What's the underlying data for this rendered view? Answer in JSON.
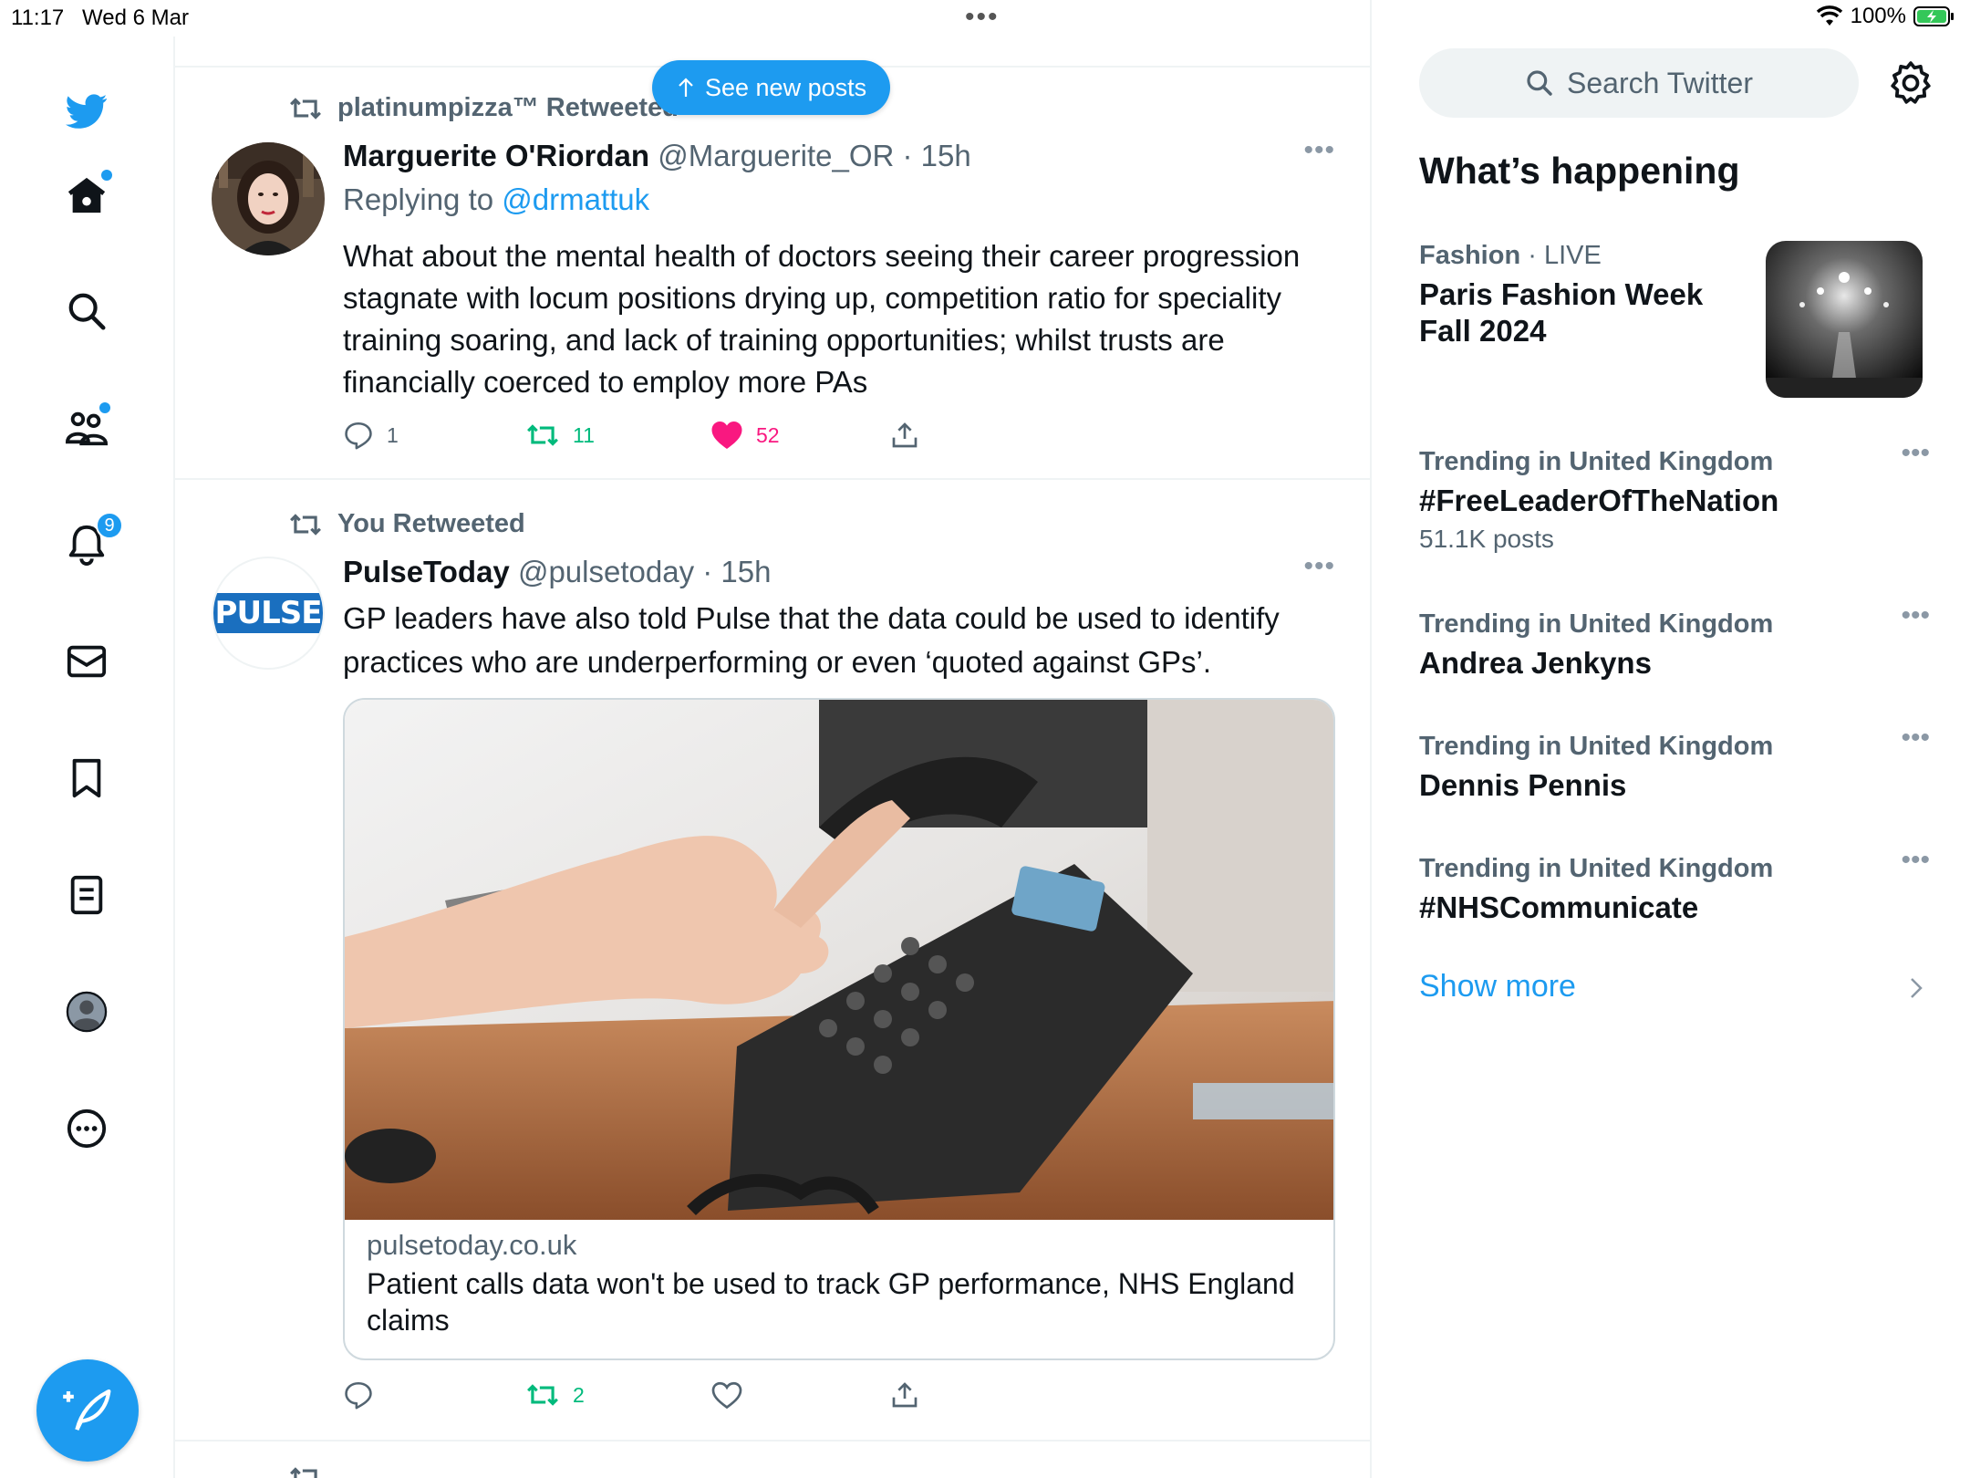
{
  "status_bar": {
    "time": "11:17",
    "date": "Wed 6 Mar",
    "battery": "100%"
  },
  "nav": {
    "notifications_badge": "9",
    "icons": [
      "twitter-logo-icon",
      "home-icon",
      "search-icon",
      "communities-icon",
      "bell-icon",
      "mail-icon",
      "bookmark-icon",
      "lists-icon",
      "profile-icon",
      "more-circle-icon",
      "compose-icon"
    ]
  },
  "banner": {
    "see_new_posts": "See new posts"
  },
  "tweets": [
    {
      "retweeted_by": "platinumpizza™ Retweeted",
      "name": "Marguerite O'Riordan",
      "handle": "@Marguerite_OR",
      "time": "· 15h",
      "replying_prefix": "Replying to ",
      "replying_to": "@drmattuk",
      "text": "What about the mental health of doctors seeing their career progression stagnate with locum positions drying up, competition ratio for speciality training soaring, and lack of training opportunities; whilst trusts are financially coerced to employ more PAs",
      "replies": "1",
      "retweets": "11",
      "likes": "52"
    },
    {
      "retweeted_by": "You Retweeted",
      "name": "PulseToday",
      "handle": "@pulsetoday",
      "time": "· 15h",
      "avatar_text": "PULSE",
      "text": "GP leaders have also told Pulse that the data could be used to identify practices who are underperforming or even ‘quoted against GPs’.",
      "card_domain": "pulsetoday.co.uk",
      "card_title": "Patient calls data won't be used to track GP performance, NHS England claims",
      "replies": "",
      "retweets": "2",
      "likes": ""
    }
  ],
  "sidebar": {
    "search_placeholder": "Search Twitter",
    "whats_happening": "What’s happening",
    "trends": [
      {
        "category": "Fashion",
        "suffix": " · LIVE",
        "topic": "Paris Fashion Week Fall 2024",
        "count": ""
      },
      {
        "category": "Trending in United Kingdom",
        "suffix": "",
        "topic": "#FreeLeaderOfTheNation",
        "count": "51.1K posts"
      },
      {
        "category": "Trending in United Kingdom",
        "suffix": "",
        "topic": "Andrea Jenkyns",
        "count": ""
      },
      {
        "category": "Trending in United Kingdom",
        "suffix": "",
        "topic": "Dennis Pennis",
        "count": ""
      },
      {
        "category": "Trending in United Kingdom",
        "suffix": "",
        "topic": "#NHSCommunicate",
        "count": ""
      }
    ],
    "show_more": "Show more"
  },
  "colors": {
    "accent": "#1d9bf0",
    "retweet_green": "#00ba7c",
    "like_pink": "#f91880",
    "secondary_text": "#536471"
  }
}
